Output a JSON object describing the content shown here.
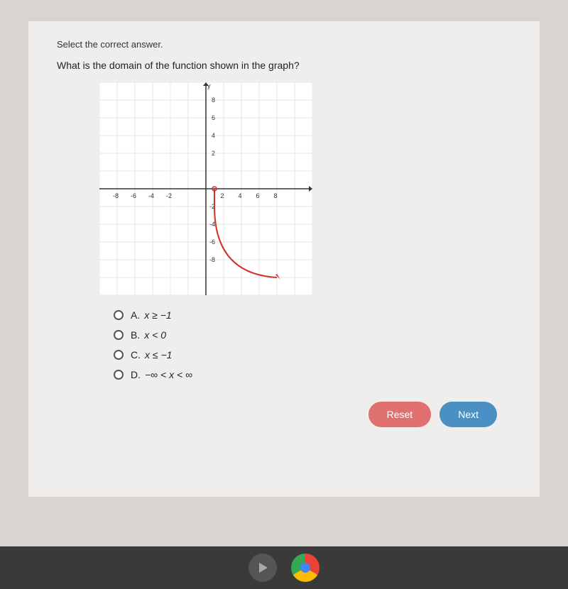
{
  "instruction": "Select the correct answer.",
  "question": "What is the domain of the function shown in the graph?",
  "answers": [
    {
      "id": "A",
      "label": "A.",
      "math": "x ≥ −1"
    },
    {
      "id": "B",
      "label": "B.",
      "math": "x < 0"
    },
    {
      "id": "C",
      "label": "C.",
      "math": "x ≤ −1"
    },
    {
      "id": "D",
      "label": "D.",
      "math": "−∞ < x < ∞"
    }
  ],
  "buttons": {
    "reset": "Reset",
    "next": "Next"
  }
}
